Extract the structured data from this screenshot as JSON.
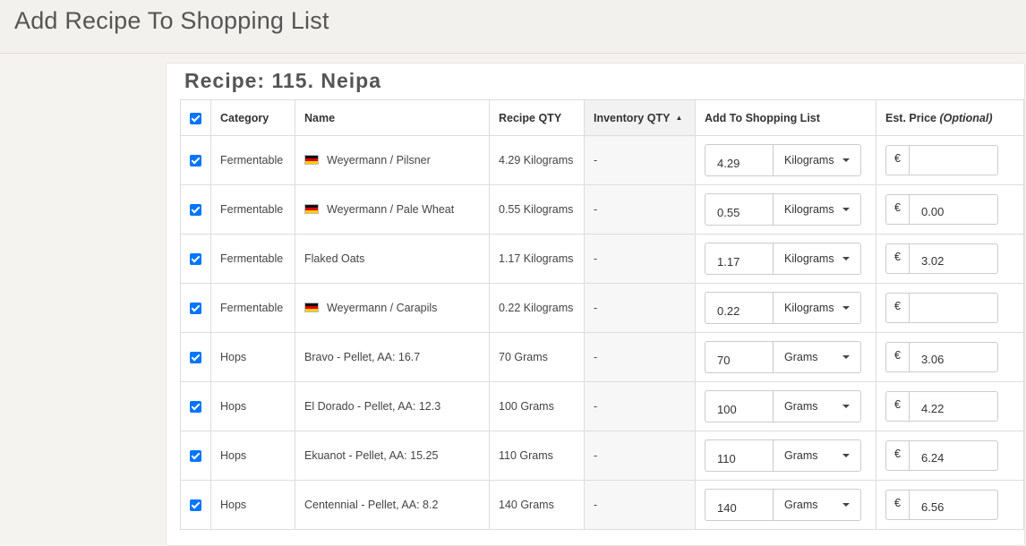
{
  "page": {
    "title": "Add Recipe To Shopping List"
  },
  "recipe": {
    "title": "Recipe: 115. Neipa"
  },
  "table": {
    "headers": {
      "category": "Category",
      "name": "Name",
      "recipe_qty": "Recipe QTY",
      "inventory_qty": "Inventory QTY",
      "add_to_list": "Add To Shopping List",
      "price": "Est. Price",
      "price_note": "(Optional)"
    },
    "currency": "€",
    "rows": [
      {
        "checked": true,
        "category": "Fermentable",
        "flag": "de",
        "name": "Weyermann / Pilsner",
        "recipe_qty": "4.29 Kilograms",
        "inventory_qty": "-",
        "qty": "4.29",
        "unit": "Kilograms",
        "price": ""
      },
      {
        "checked": true,
        "category": "Fermentable",
        "flag": "de",
        "name": "Weyermann / Pale Wheat",
        "recipe_qty": "0.55 Kilograms",
        "inventory_qty": "-",
        "qty": "0.55",
        "unit": "Kilograms",
        "price": "0.00"
      },
      {
        "checked": true,
        "category": "Fermentable",
        "flag": "",
        "name": "Flaked Oats",
        "recipe_qty": "1.17 Kilograms",
        "inventory_qty": "-",
        "qty": "1.17",
        "unit": "Kilograms",
        "price": "3.02"
      },
      {
        "checked": true,
        "category": "Fermentable",
        "flag": "de",
        "name": "Weyermann / Carapils",
        "recipe_qty": "0.22 Kilograms",
        "inventory_qty": "-",
        "qty": "0.22",
        "unit": "Kilograms",
        "price": ""
      },
      {
        "checked": true,
        "category": "Hops",
        "flag": "",
        "name": "Bravo - Pellet, AA: 16.7",
        "recipe_qty": "70 Grams",
        "inventory_qty": "-",
        "qty": "70",
        "unit": "Grams",
        "price": "3.06"
      },
      {
        "checked": true,
        "category": "Hops",
        "flag": "",
        "name": "El Dorado - Pellet, AA: 12.3",
        "recipe_qty": "100 Grams",
        "inventory_qty": "-",
        "qty": "100",
        "unit": "Grams",
        "price": "4.22"
      },
      {
        "checked": true,
        "category": "Hops",
        "flag": "",
        "name": "Ekuanot - Pellet, AA: 15.25",
        "recipe_qty": "110 Grams",
        "inventory_qty": "-",
        "qty": "110",
        "unit": "Grams",
        "price": "6.24"
      },
      {
        "checked": true,
        "category": "Hops",
        "flag": "",
        "name": "Centennial - Pellet, AA: 8.2",
        "recipe_qty": "140 Grams",
        "inventory_qty": "-",
        "qty": "140",
        "unit": "Grams",
        "price": "6.56"
      }
    ]
  }
}
